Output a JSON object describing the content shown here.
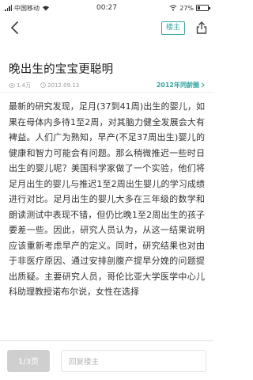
{
  "status": {
    "carrier": "中国移动",
    "time": "00:27",
    "battery": "27%",
    "battery_level": 0.27
  },
  "header": {
    "louzhu_label": "楼主"
  },
  "post": {
    "title": "晚出生的宝宝更聪明",
    "views": "1.4万",
    "date": "2012.09.13",
    "topic_link": "2012年同龄圈",
    "body": "最新的研究发现，足月(37到41周)出生的婴儿，如果在母体内多待1至2周，对其脑力健全发展会大有裨益。人们广为熟知，早产(不足37周出生)婴儿的健康和智力可能会有问题。那么稍微推迟一些时日出生的婴儿呢？美国科学家做了一个实验，他们将足月出生的婴儿与推迟1至2周出生婴儿的学习成绩进行对比。足月出生的婴儿大多在三年级的数学和朗读测试中表现不错，但仍比晚1至2周出生的孩子要差一些。因此，研究人员认为，从这一结果说明应该重新考虑早产的定义。同时，研究结果也对由于非医疗原因、通过安排剖腹产提早分娩的问题提出质疑。主要研究人员，哥伦比亚大学医学中心儿科助理教授诺布尔说，女性在选择"
  },
  "footer": {
    "page_label": "1/3页",
    "reply_placeholder": "回复楼主"
  },
  "colors": {
    "accent": "#33a7a3"
  }
}
